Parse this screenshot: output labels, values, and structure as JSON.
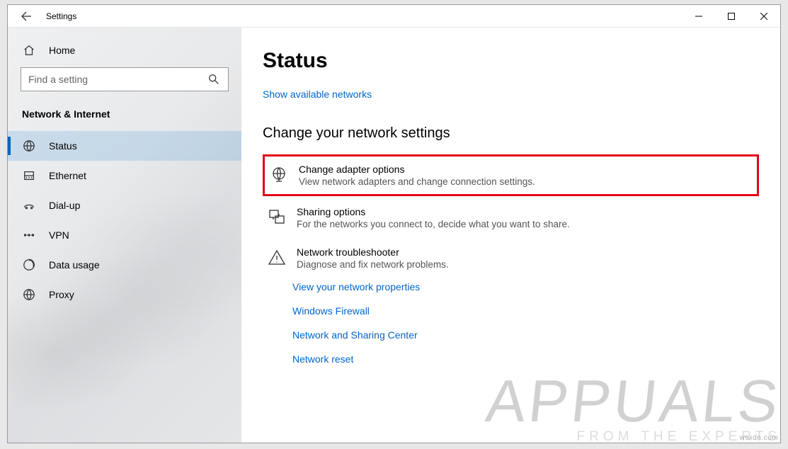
{
  "window": {
    "title": "Settings"
  },
  "sidebar": {
    "home": "Home",
    "search_placeholder": "Find a setting",
    "section": "Network & Internet",
    "items": [
      {
        "label": "Status"
      },
      {
        "label": "Ethernet"
      },
      {
        "label": "Dial-up"
      },
      {
        "label": "VPN"
      },
      {
        "label": "Data usage"
      },
      {
        "label": "Proxy"
      }
    ]
  },
  "main": {
    "title": "Status",
    "show_networks": "Show available networks",
    "change_heading": "Change your network settings",
    "options": [
      {
        "title": "Change adapter options",
        "desc": "View network adapters and change connection settings."
      },
      {
        "title": "Sharing options",
        "desc": "For the networks you connect to, decide what you want to share."
      },
      {
        "title": "Network troubleshooter",
        "desc": "Diagnose and fix network problems."
      }
    ],
    "links": [
      "View your network properties",
      "Windows Firewall",
      "Network and Sharing Center",
      "Network reset"
    ]
  },
  "watermark": {
    "main": "APPUALS",
    "sub": "FROM  THE  EXPERTS",
    "corner": "wsxdn.com"
  }
}
